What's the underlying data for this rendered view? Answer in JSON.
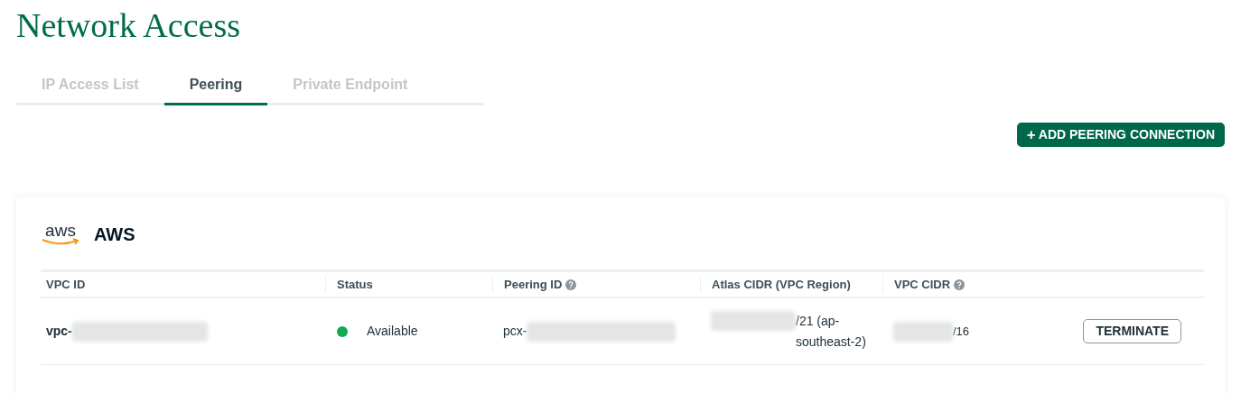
{
  "title": "Network Access",
  "tabs": [
    {
      "label": "IP Access List",
      "selected": false
    },
    {
      "label": "Peering",
      "selected": true
    },
    {
      "label": "Private Endpoint",
      "selected": false
    }
  ],
  "add_button": {
    "icon": "+",
    "label": "ADD PEERING CONNECTION"
  },
  "provider": {
    "logo_text": "aws",
    "name": "AWS"
  },
  "table": {
    "columns": [
      {
        "label": "VPC ID",
        "help": false
      },
      {
        "label": "Status",
        "help": false
      },
      {
        "label": "Peering ID",
        "help": true
      },
      {
        "label": "Atlas CIDR (VPC Region)",
        "help": false
      },
      {
        "label": "VPC CIDR",
        "help": true
      }
    ],
    "rows": [
      {
        "vpc_id": "vpc-",
        "status": {
          "label": "Available",
          "color": "#13aa52"
        },
        "peering_id": "pcx-",
        "atlas_cidr": "/21 (ap-southeast-2)",
        "vpc_cidr": "/16",
        "action": "TERMINATE"
      }
    ]
  }
}
